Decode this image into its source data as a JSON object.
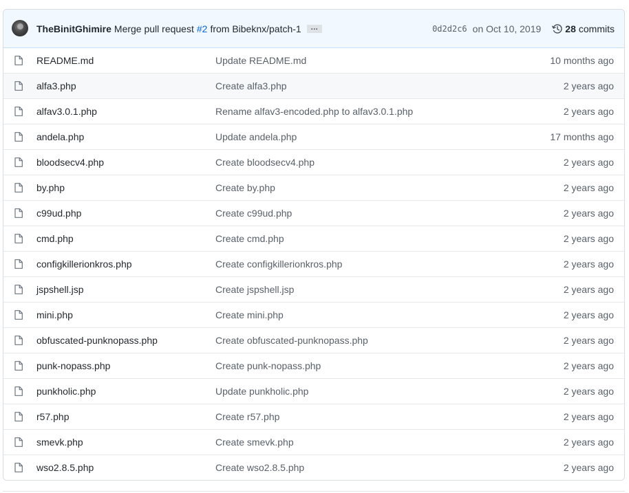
{
  "commit": {
    "author": "TheBinitGhimire",
    "message_prefix": "Merge pull request",
    "pr_link": "#2",
    "message_suffix": "from Bibeknx/patch-1",
    "ellipsis": "…",
    "sha": "0d2d2c6",
    "date": "on Oct 10, 2019",
    "commits_count": "28",
    "commits_label": "commits"
  },
  "files": [
    {
      "name": "README.md",
      "message": "Update README.md",
      "age": "10 months ago"
    },
    {
      "name": "alfa3.php",
      "message": "Create alfa3.php",
      "age": "2 years ago"
    },
    {
      "name": "alfav3.0.1.php",
      "message": "Rename alfav3-encoded.php to alfav3.0.1.php",
      "age": "2 years ago"
    },
    {
      "name": "andela.php",
      "message": "Update andela.php",
      "age": "17 months ago"
    },
    {
      "name": "bloodsecv4.php",
      "message": "Create bloodsecv4.php",
      "age": "2 years ago"
    },
    {
      "name": "by.php",
      "message": "Create by.php",
      "age": "2 years ago"
    },
    {
      "name": "c99ud.php",
      "message": "Create c99ud.php",
      "age": "2 years ago"
    },
    {
      "name": "cmd.php",
      "message": "Create cmd.php",
      "age": "2 years ago"
    },
    {
      "name": "configkillerionkros.php",
      "message": "Create configkillerionkros.php",
      "age": "2 years ago"
    },
    {
      "name": "jspshell.jsp",
      "message": "Create jspshell.jsp",
      "age": "2 years ago"
    },
    {
      "name": "mini.php",
      "message": "Create mini.php",
      "age": "2 years ago"
    },
    {
      "name": "obfuscated-punknopass.php",
      "message": "Create obfuscated-punknopass.php",
      "age": "2 years ago"
    },
    {
      "name": "punk-nopass.php",
      "message": "Create punk-nopass.php",
      "age": "2 years ago"
    },
    {
      "name": "punkholic.php",
      "message": "Update punkholic.php",
      "age": "2 years ago"
    },
    {
      "name": "r57.php",
      "message": "Create r57.php",
      "age": "2 years ago"
    },
    {
      "name": "smevk.php",
      "message": "Create smevk.php",
      "age": "2 years ago"
    },
    {
      "name": "wso2.8.5.php",
      "message": "Create wso2.8.5.php",
      "age": "2 years ago"
    }
  ],
  "icons": {
    "file": "file-icon",
    "history": "history-icon",
    "avatar": "avatar"
  },
  "colors": {
    "commit_bar_bg": "#f1f8ff",
    "link": "#0366d6",
    "muted": "#586069",
    "border": "#e1e4e8"
  }
}
